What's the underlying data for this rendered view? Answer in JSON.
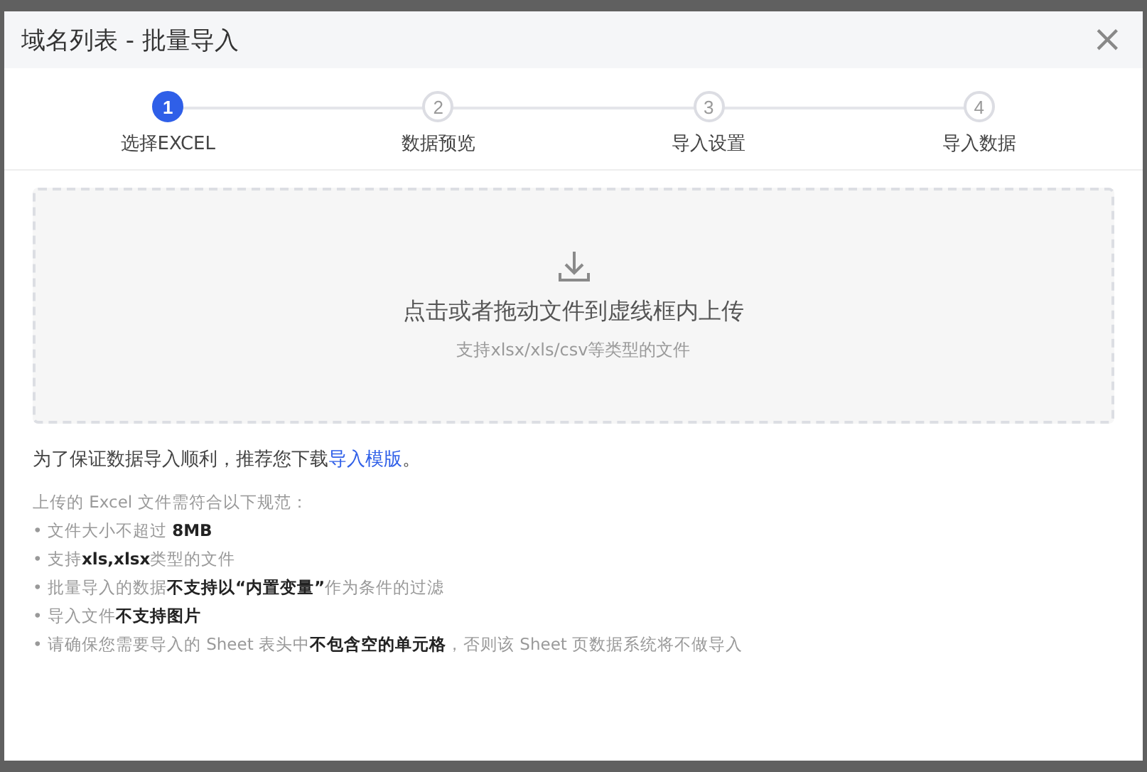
{
  "dialog": {
    "title": "域名列表 - 批量导入",
    "close": "×"
  },
  "steps": [
    {
      "number": "1",
      "label": "选择EXCEL",
      "selected": true
    },
    {
      "number": "2",
      "label": "数据预览",
      "selected": false
    },
    {
      "number": "3",
      "label": "导入设置",
      "selected": false
    },
    {
      "number": "4",
      "label": "导入数据",
      "selected": false
    }
  ],
  "upload": {
    "title": "点击或者拖动文件到虚线框内上传",
    "hint": "支持xlsx/xls/csv等类型的文件"
  },
  "notice": {
    "before": "为了保证数据导入顺利，推荐您下载",
    "link": "导入模版",
    "after": "。"
  },
  "rules": [
    "上传的 Excel 文件需符合以下规范：",
    "• 文件大小不超过 **8MB**",
    "• 支持**xls,xlsx**类型的文件",
    "• 批量导入的数据**不支持以“内置变量”**作为条件的过滤",
    "• 导入文件**不支持图片**",
    "• 请确保您需要导入的 Sheet 表头中**不包含空的单元格**，否则该 Sheet 页数据系统将不做导入"
  ]
}
